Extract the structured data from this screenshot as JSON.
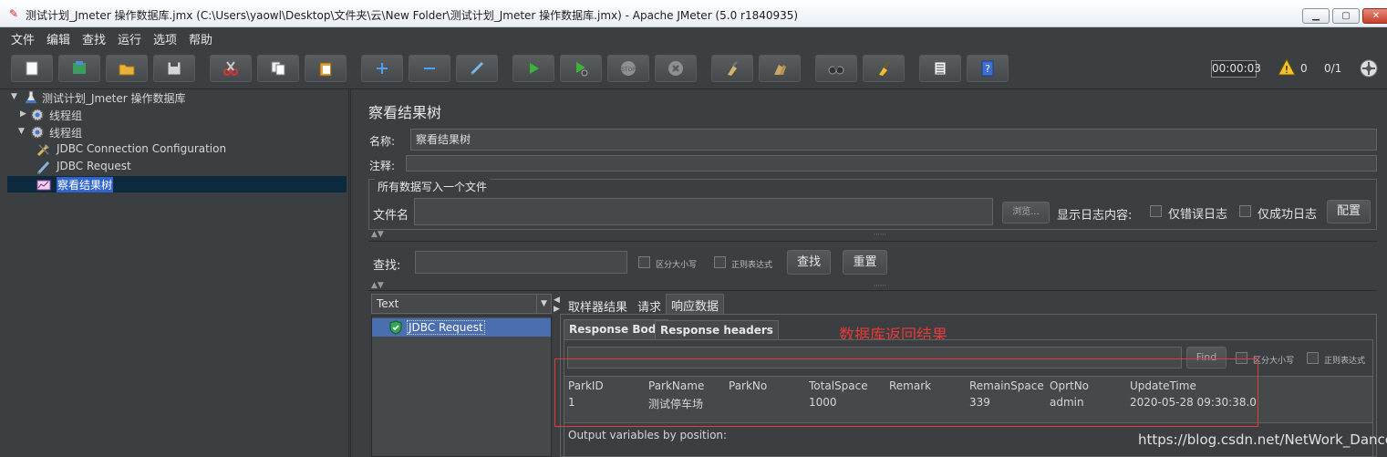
{
  "window": {
    "title": "测试计划_Jmeter 操作数据库.jmx (C:\\Users\\yaowl\\Desktop\\文件夹\\云\\New Folder\\测试计划_Jmeter 操作数据库.jmx) - Apache JMeter (5.0 r1840935)"
  },
  "menu": [
    "文件",
    "编辑",
    "查找",
    "运行",
    "选项",
    "帮助"
  ],
  "toolbar": {
    "buttons": [
      "new-icon",
      "templates-icon",
      "open-icon",
      "save-icon",
      "cut-icon",
      "copy-icon",
      "paste-icon",
      "expand-icon",
      "collapse-icon",
      "toggle-icon",
      "start-icon",
      "start-no-pause-icon",
      "stop-icon",
      "shutdown-icon",
      "clear-icon",
      "clear-all-icon",
      "search-icon",
      "reset-search-icon",
      "function-helper-icon",
      "help-icon"
    ],
    "timer": "00:00:03",
    "warnings": "0",
    "threads": "0/1"
  },
  "tree": {
    "items": [
      {
        "label": "测试计划_Jmeter 操作数据库",
        "icon": "test-plan-icon",
        "expanded": true,
        "depth": 0
      },
      {
        "label": "线程组",
        "icon": "thread-group-icon",
        "expanded": false,
        "depth": 1
      },
      {
        "label": "线程组",
        "icon": "thread-group-icon",
        "expanded": true,
        "depth": 1
      },
      {
        "label": "JDBC Connection Configuration",
        "icon": "config-icon",
        "depth": 2
      },
      {
        "label": "JDBC Request",
        "icon": "sampler-icon",
        "depth": 2
      },
      {
        "label": "察看结果树",
        "icon": "listener-icon",
        "depth": 2,
        "selected": true
      }
    ]
  },
  "panel": {
    "title": "察看结果树",
    "name_label": "名称:",
    "name_value": "察看结果树",
    "comment_label": "注释:",
    "comment_value": "",
    "file_section": "所有数据写入一个文件",
    "filename_label": "文件名",
    "filename_value": "",
    "browse": "浏览...",
    "log_label": "显示日志内容:",
    "errors_only": "仅错误日志",
    "success_only": "仅成功日志",
    "configure": "配置"
  },
  "search": {
    "label": "查找:",
    "value": "",
    "case_sensitive": "区分大小写",
    "regex": "正则表达式",
    "find_button": "查找",
    "reset_button": "重置"
  },
  "results": {
    "renderer": "Text",
    "samples": [
      {
        "label": "JDBC Request",
        "status": "success"
      }
    ],
    "tabs": [
      "取样器结果",
      "请求",
      "响应数据"
    ],
    "active_tab": "响应数据",
    "subtabs": [
      "Response Body",
      "Response headers"
    ],
    "active_subtab": "Response Body",
    "find_button": "Find",
    "case_sensitive": "区分大小写",
    "regex": "正则表达式",
    "annotation": "数据库返回结果",
    "table": {
      "columns": [
        "ParkID",
        "ParkName",
        "ParkNo",
        "TotalSpace",
        "Remark",
        "RemainSpace",
        "OprtNo",
        "UpdateTime"
      ],
      "rows": [
        [
          "1",
          "测试停车场",
          "",
          "1000",
          "",
          "339",
          "admin",
          "2020-05-28 09:30:38.0"
        ]
      ]
    },
    "output_label": "Output variables by position:"
  },
  "watermark": "https://blog.csdn.net/NetWork_Dance"
}
